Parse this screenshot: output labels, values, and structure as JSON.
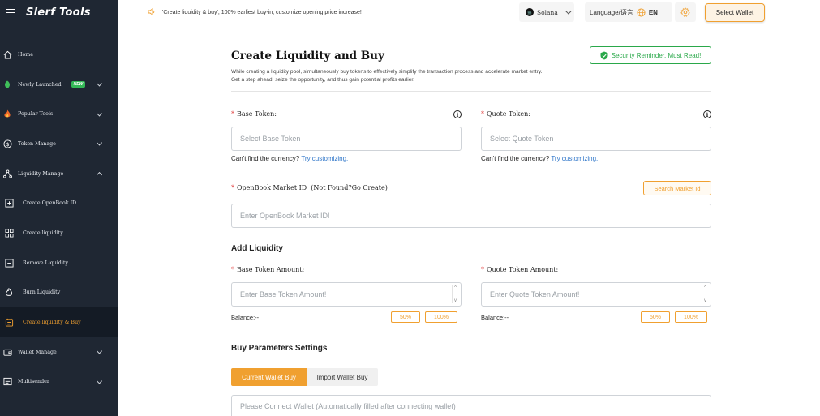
{
  "app": {
    "name": "Slerf Tools"
  },
  "sidebar": {
    "items": [
      {
        "label": "Home",
        "icon": "home-icon",
        "badge": "",
        "chevron": false
      },
      {
        "label": "Newly Launched",
        "icon": "leaf-icon",
        "badge": "NEW",
        "chevron": true
      },
      {
        "label": "Popular Tools",
        "icon": "fire-icon",
        "badge": "",
        "chevron": true
      },
      {
        "label": "Token Manage",
        "icon": "dollar-icon",
        "badge": "",
        "chevron": true
      },
      {
        "label": "Liquidity Manage",
        "icon": "nodes-icon",
        "badge": "",
        "chevron": true,
        "expanded": true
      },
      {
        "label": "Create OpenBook ID",
        "icon": "plus-square-icon",
        "sub": true
      },
      {
        "label": "Create liquidity",
        "icon": "grid-icon",
        "sub": true
      },
      {
        "label": "Remove Liquidity",
        "icon": "minus-square-icon",
        "sub": true
      },
      {
        "label": "Burn Liquidity",
        "icon": "flame-icon",
        "sub": true
      },
      {
        "label": "Create liquidity & Buy",
        "icon": "cart-icon",
        "sub": true,
        "active": true
      },
      {
        "label": "Wallet Manage",
        "icon": "wallet-icon",
        "badge": "",
        "chevron": true
      },
      {
        "label": "Multisender",
        "icon": "send-icon",
        "badge": "",
        "chevron": true
      }
    ]
  },
  "topbar": {
    "notice": "'Create liquidity & buy', 100% earliest buy-in, customize opening price increase!",
    "network": "Solana",
    "language": "Language/语言",
    "lang_code": "EN",
    "select_wallet": "Select Wallet"
  },
  "main": {
    "title": "Create Liquidity and Buy",
    "desc_line1": "While creating a liquidity pool, simultaneously buy tokens to effectively simplify the transaction process and accelerate market entry.",
    "desc_line2": "Get a step ahead, seize the opportunity, and thus gain potential profits earlier.",
    "security": "Security Reminder, Must Read!",
    "base_token_label": "Base Token:",
    "base_token_placeholder": "Select Base Token",
    "quote_token_label": "Quote Token:",
    "quote_token_placeholder": "Select Quote Token",
    "cant_find": "Can't find the currency?",
    "try_custom": "Try customizing.",
    "market_label": "OpenBook Market ID",
    "market_hint": "(Not Found?Go Create)",
    "search_market": "Search Market Id",
    "market_placeholder": "Enter OpenBook Market ID!",
    "add_liquidity": "Add Liquidity",
    "base_amount_label": "Base Token Amount:",
    "base_amount_placeholder": "Enter Base Token Amount!",
    "quote_amount_label": "Quote Token Amount:",
    "quote_amount_placeholder": "Enter Quote Token Amount!",
    "balance": "Balance:--",
    "pct50": "50%",
    "pct100": "100%",
    "buy_params": "Buy Parameters Settings",
    "tab_current": "Current Wallet Buy",
    "tab_import": "Import Wallet Buy",
    "wallet_placeholder": "Please Connect Wallet (Automatically filled after connecting wallet)"
  },
  "colors": {
    "accent": "#f0a030",
    "sidebar": "#1f2733",
    "success": "#2aa84a",
    "link": "#2f76c9"
  }
}
